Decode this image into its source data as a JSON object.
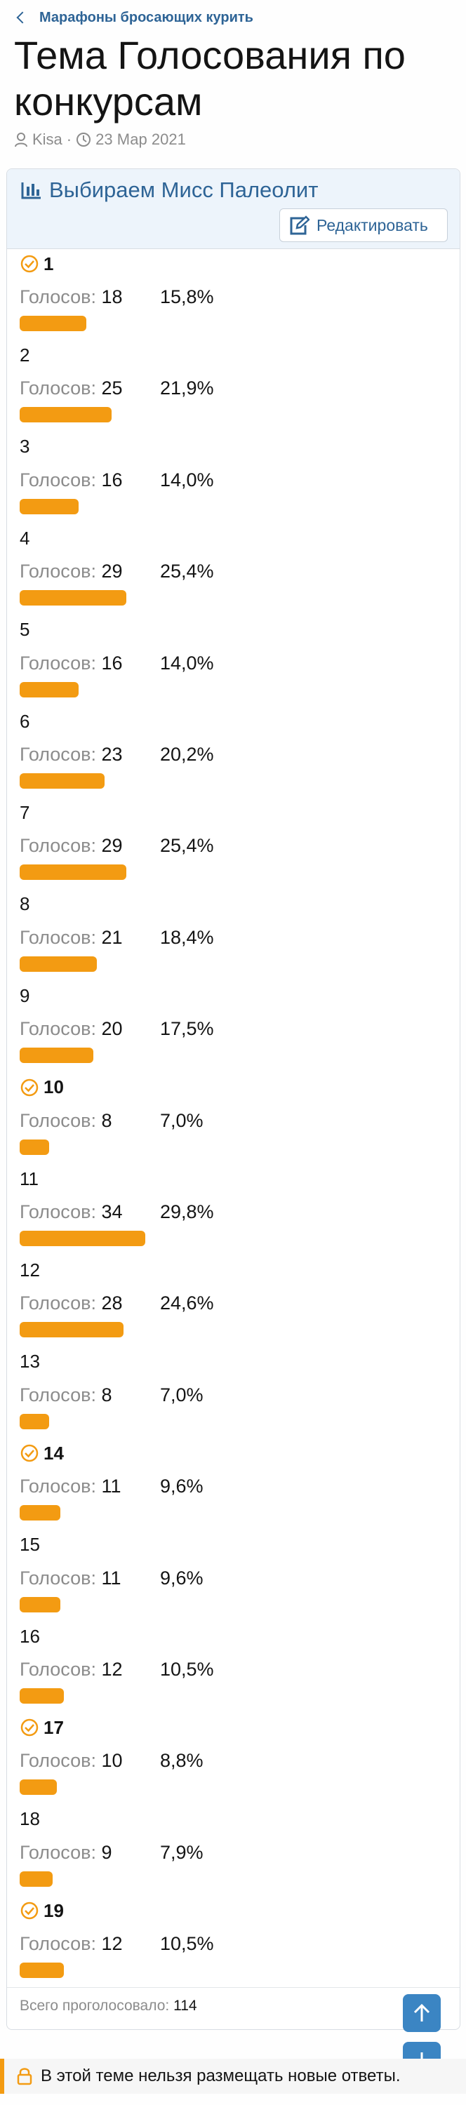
{
  "breadcrumb": {
    "label": "Марафоны бросающих курить"
  },
  "thread": {
    "title": "Тема Голосования по конкурсам",
    "author": "Kisa",
    "date": "23 Мар 2021"
  },
  "poll": {
    "title": "Выбираем Мисс Палеолит",
    "edit_label": "Редактировать",
    "votes_prefix": "Голосов:",
    "options": [
      {
        "label": "1",
        "votes": "18",
        "percent": "15,8%",
        "share": 15.8,
        "selected": true
      },
      {
        "label": "2",
        "votes": "25",
        "percent": "21,9%",
        "share": 21.9,
        "selected": false
      },
      {
        "label": "3",
        "votes": "16",
        "percent": "14,0%",
        "share": 14.0,
        "selected": false
      },
      {
        "label": "4",
        "votes": "29",
        "percent": "25,4%",
        "share": 25.4,
        "selected": false
      },
      {
        "label": "5",
        "votes": "16",
        "percent": "14,0%",
        "share": 14.0,
        "selected": false
      },
      {
        "label": "6",
        "votes": "23",
        "percent": "20,2%",
        "share": 20.2,
        "selected": false
      },
      {
        "label": "7",
        "votes": "29",
        "percent": "25,4%",
        "share": 25.4,
        "selected": false
      },
      {
        "label": "8",
        "votes": "21",
        "percent": "18,4%",
        "share": 18.4,
        "selected": false
      },
      {
        "label": "9",
        "votes": "20",
        "percent": "17,5%",
        "share": 17.5,
        "selected": false
      },
      {
        "label": "10",
        "votes": "8",
        "percent": "7,0%",
        "share": 7.0,
        "selected": true
      },
      {
        "label": "11",
        "votes": "34",
        "percent": "29,8%",
        "share": 29.8,
        "selected": false
      },
      {
        "label": "12",
        "votes": "28",
        "percent": "24,6%",
        "share": 24.6,
        "selected": false
      },
      {
        "label": "13",
        "votes": "8",
        "percent": "7,0%",
        "share": 7.0,
        "selected": false
      },
      {
        "label": "14",
        "votes": "11",
        "percent": "9,6%",
        "share": 9.6,
        "selected": true
      },
      {
        "label": "15",
        "votes": "11",
        "percent": "9,6%",
        "share": 9.6,
        "selected": false
      },
      {
        "label": "16",
        "votes": "12",
        "percent": "10,5%",
        "share": 10.5,
        "selected": false
      },
      {
        "label": "17",
        "votes": "10",
        "percent": "8,8%",
        "share": 8.8,
        "selected": true
      },
      {
        "label": "18",
        "votes": "9",
        "percent": "7,9%",
        "share": 7.9,
        "selected": false
      },
      {
        "label": "19",
        "votes": "12",
        "percent": "10,5%",
        "share": 10.5,
        "selected": true
      }
    ],
    "total_label": "Всего проголосовало:",
    "total_value": "114"
  },
  "notice": {
    "text": "В этой теме нельзя размещать новые ответы."
  },
  "colors": {
    "accent": "#f39b12",
    "link": "#2e6496",
    "button": "#3b85c3"
  },
  "icons": [
    "back-arrow-icon",
    "user-icon",
    "clock-icon",
    "bar-chart-icon",
    "edit-icon",
    "check-circle-icon",
    "arrow-up-icon",
    "arrow-down-icon",
    "lock-icon"
  ]
}
